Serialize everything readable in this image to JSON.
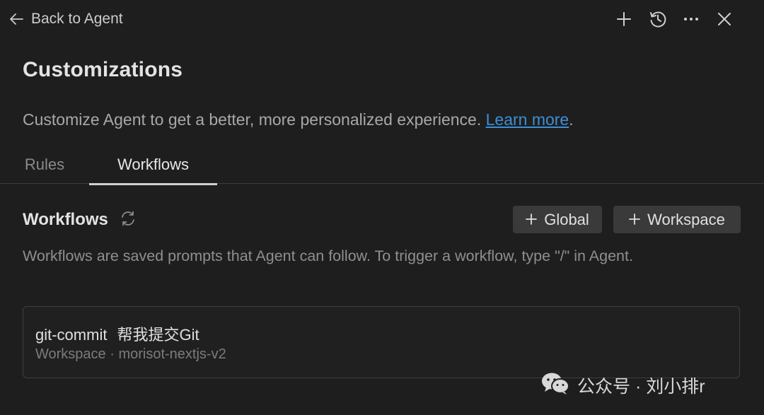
{
  "topbar": {
    "back_label": "Back to Agent",
    "icons": [
      "plus-icon",
      "history-icon",
      "more-icon",
      "close-icon"
    ]
  },
  "page": {
    "title": "Customizations",
    "subtitle": "Customize Agent to get a better, more personalized experience.",
    "learn_more": "Learn more",
    "subtitle_end": "."
  },
  "tabs": [
    {
      "label": "Rules",
      "active": false
    },
    {
      "label": "Workflows",
      "active": true
    }
  ],
  "workflows": {
    "section_title": "Workflows",
    "global_button": "Global",
    "workspace_button": "Workspace",
    "description": "Workflows are saved prompts that Agent can follow. To trigger a workflow, type \"/\" in Agent.",
    "items": [
      {
        "name": "git-commit",
        "summary": "帮我提交Git",
        "meta": "Workspace · morisot-nextjs-v2"
      }
    ]
  },
  "watermark": {
    "text": "公众号 · 刘小排r"
  },
  "colors": {
    "background": "#1e1e1e",
    "link": "#3c8fd6",
    "button": "#3a3a3a"
  }
}
